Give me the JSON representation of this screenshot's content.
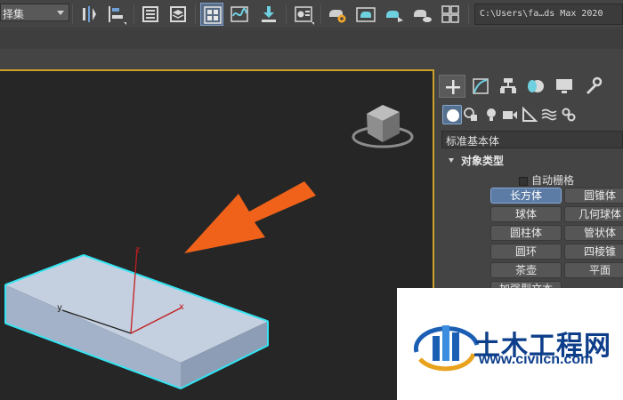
{
  "toolbar": {
    "selection_set_label": "择集",
    "path_text": "C:\\Users\\fa…ds Max 2020"
  },
  "viewport": {
    "axis_x": "x",
    "axis_y": "y",
    "axis_z": "z",
    "box_fill": "#b7c4d6",
    "selection_color": "#33e4f2",
    "arrow_color": "#f0621a"
  },
  "command_panel": {
    "category": "标准基本体",
    "rollout_title": "对象类型",
    "autogrid_label": "自动栅格",
    "buttons": [
      "长方体",
      "圆锥体",
      "球体",
      "几何球体",
      "圆柱体",
      "管状体",
      "圆环",
      "四棱锥",
      "茶壶",
      "平面",
      "加强型文本"
    ],
    "active_button": "长方体"
  },
  "watermark": {
    "name": "土木工程网",
    "url": "www.civilcn.com"
  }
}
